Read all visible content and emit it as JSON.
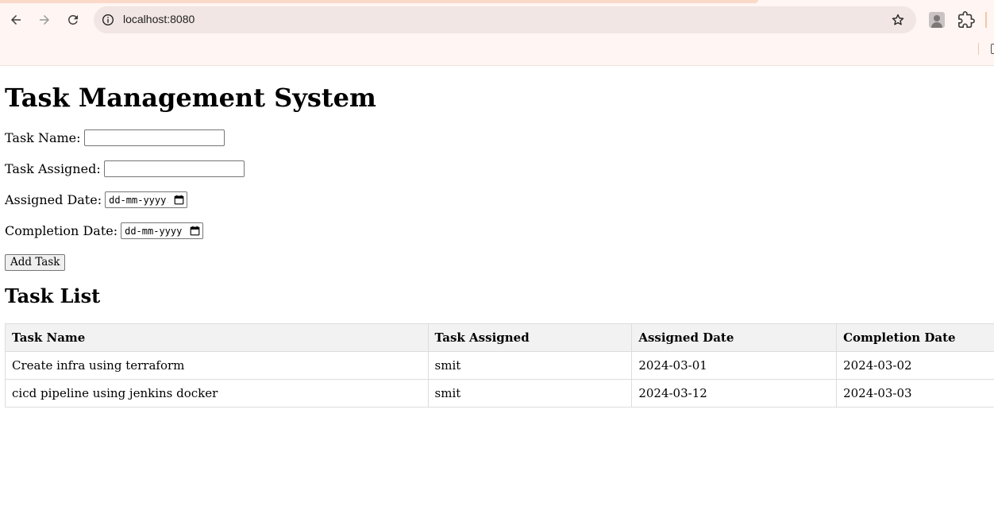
{
  "browser": {
    "url": "localhost:8080"
  },
  "page": {
    "title": "Task Management System",
    "form": {
      "task_name_label": "Task Name:",
      "task_name_value": "",
      "task_assigned_label": "Task Assigned:",
      "task_assigned_value": "",
      "assigned_date_label": "Assigned Date:",
      "assigned_date_placeholder": "dd-mm-yyyy",
      "completion_date_label": "Completion Date:",
      "completion_date_placeholder": "dd-mm-yyyy",
      "add_button_label": "Add Task"
    },
    "list_heading": "Task List",
    "table": {
      "headers": [
        "Task Name",
        "Task Assigned",
        "Assigned Date",
        "Completion Date"
      ],
      "rows": [
        [
          "Create infra using terraform",
          "smit",
          "2024-03-01",
          "2024-03-02"
        ],
        [
          "cicd pipeline using jenkins docker",
          "smit",
          "2024-03-12",
          "2024-03-03"
        ]
      ]
    }
  }
}
